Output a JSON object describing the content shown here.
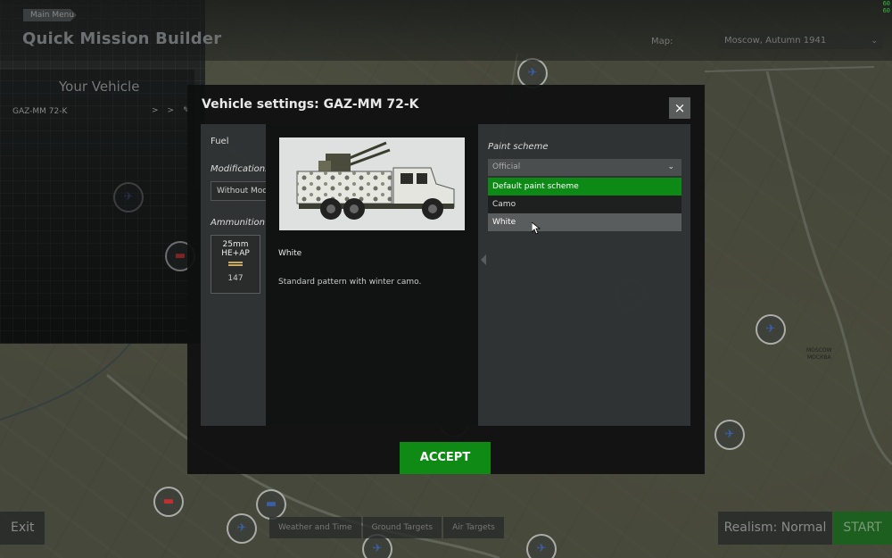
{
  "header": {
    "main_menu_label": "Main Menu",
    "title": "Quick Mission Builder",
    "map_label": "Map:",
    "map_value": "Moscow, Autumn 1941",
    "indicator": "60\n60"
  },
  "your_vehicle": {
    "title": "Your Vehicle",
    "name": "GAZ-MM 72-K",
    "icons": [
      ">>",
      "✎"
    ]
  },
  "modal": {
    "title": "Vehicle settings: GAZ-MM 72-K",
    "close_icon": "×",
    "fuel_label": "Fuel",
    "modifications_label": "Modifications",
    "modifications_value": "Without Modifications",
    "ammo_label": "Ammunition scheme",
    "ammo": {
      "name": "25mm HE+AP",
      "count": "147"
    },
    "preview": {
      "name": "White",
      "description": "Standard pattern with winter camo."
    },
    "paint_scheme_label": "Paint scheme",
    "paint_scheme_value": "Official",
    "paint_options": [
      "Default paint scheme",
      "Camo",
      "White"
    ],
    "selected_option_index": 0,
    "hovered_option_index": 2,
    "accept_label": "ACCEPT"
  },
  "bottom": {
    "exit_label": "Exit",
    "tabs": [
      "Weather and Time",
      "Ground Targets",
      "Air Targets"
    ],
    "realism_label": "Realism: Normal",
    "start_label": "START"
  },
  "map_town": "MOSCOW\nМОСКВА",
  "colors": {
    "accent_green": "#0f8a15",
    "modal_bg": "#0e0f0f",
    "panel_bg": "#343737",
    "friendly_marker": "#3b5ea8",
    "enemy_marker": "#c03030"
  }
}
